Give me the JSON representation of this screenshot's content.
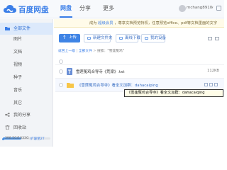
{
  "brand": {
    "name": "百度网盘",
    "color": "#3a7ee8"
  },
  "nav": {
    "disk": "网盘",
    "share": "分享",
    "more": "更多"
  },
  "user": {
    "name": "mchang8910"
  },
  "notice": {
    "prefix": "成为",
    "highlight": "超级会员",
    "suffix": "，尊享文档预览特权，任意预览office、pdf等文档里面的文字"
  },
  "sidebar": {
    "items": [
      {
        "label": "全部文件",
        "icon": "folder-icon",
        "active": true
      },
      {
        "label": "图片"
      },
      {
        "label": "文档"
      },
      {
        "label": "视频"
      },
      {
        "label": "种子"
      },
      {
        "label": "音乐"
      },
      {
        "label": "其它"
      },
      {
        "label": "我的分享",
        "icon": "share-icon"
      },
      {
        "label": "回收站",
        "icon": "trash-icon"
      }
    ],
    "quota": {
      "text": "398.5G/1033G",
      "expand": "扩容至2T",
      "fraction": 0.39
    }
  },
  "toolbar": {
    "upload": "上传",
    "new_folder": "新建文件夹",
    "offline_download": "离线下载",
    "my_device": "我的设备"
  },
  "breadcrumb": {
    "back": "返回上一级",
    "all_files": "全部文件",
    "search": "搜索：\"雪莲冤鸡\""
  },
  "files": [
    {
      "name": "雪莲冤鸡合导寺《荒梁》.txt",
      "size": "112KB",
      "type": "txt-file-icon"
    },
    {
      "name": "《雪莲冤鸡合导寺》看全文加群：dahacaiping",
      "size": "",
      "type": "folder-icon"
    }
  ],
  "tooltip": {
    "text": "《雪莲冤鸡合导寺》看全文加群：dahacaiqing"
  },
  "colors": {
    "accent": "#3f84e5",
    "sidebar_active": "#dce9fb",
    "notice_bg": "#fffbe9"
  }
}
